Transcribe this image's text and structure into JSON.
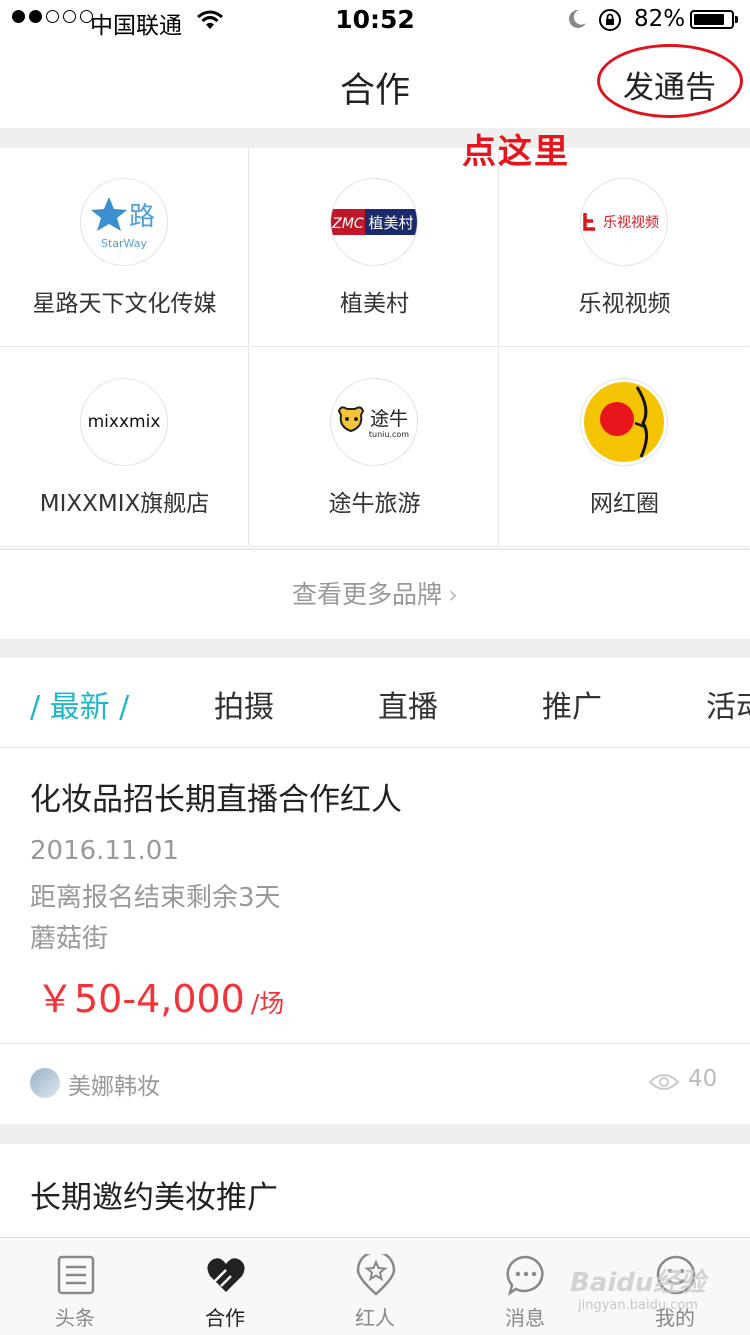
{
  "status": {
    "carrier": "中国联通",
    "time": "10:52",
    "battery": "82%",
    "battery_level": 0.82
  },
  "nav": {
    "title": "合作",
    "announce_button": "发通告"
  },
  "callout": "点这里",
  "brands": [
    {
      "name": "星路天下文化传媒",
      "logo_text": "星路",
      "logo_sub": "StarWay"
    },
    {
      "name": "植美村",
      "logo_text": "ZMC",
      "logo_sub": "植美村"
    },
    {
      "name": "乐视视频",
      "logo_text": "乐视视频"
    },
    {
      "name": "MIXXMIX旗舰店",
      "logo_text": "mixxmix"
    },
    {
      "name": "途牛旅游",
      "logo_text": "途牛",
      "logo_sub": "tuniu.com"
    },
    {
      "name": "网红圈",
      "logo_text": ""
    }
  ],
  "more_brands": "查看更多品牌",
  "tabs": [
    "/ 最新 /",
    "拍摄",
    "直播",
    "推广",
    "活动"
  ],
  "posts": [
    {
      "title": "化妆品招长期直播合作红人",
      "date": "2016.11.01",
      "deadline": "距离报名结束剩余3天",
      "location": "蘑菇街",
      "price": "￥50-4,000",
      "price_unit": "/场",
      "author": "美娜韩妆",
      "views": "40"
    },
    {
      "title": "长期邀约美妆推广"
    }
  ],
  "tabbar": [
    {
      "label": "头条",
      "icon": "news-icon"
    },
    {
      "label": "合作",
      "icon": "handshake-heart-icon"
    },
    {
      "label": "红人",
      "icon": "star-badge-icon"
    },
    {
      "label": "消息",
      "icon": "chat-bubble-icon"
    },
    {
      "label": "我的",
      "icon": "smiley-icon"
    }
  ],
  "watermark": {
    "brand": "Baidu经验",
    "url": "jingyan.baidu.com"
  },
  "colors": {
    "accent": "#1fb8c5",
    "price": "#f2343a",
    "annotation": "#e0141e"
  }
}
